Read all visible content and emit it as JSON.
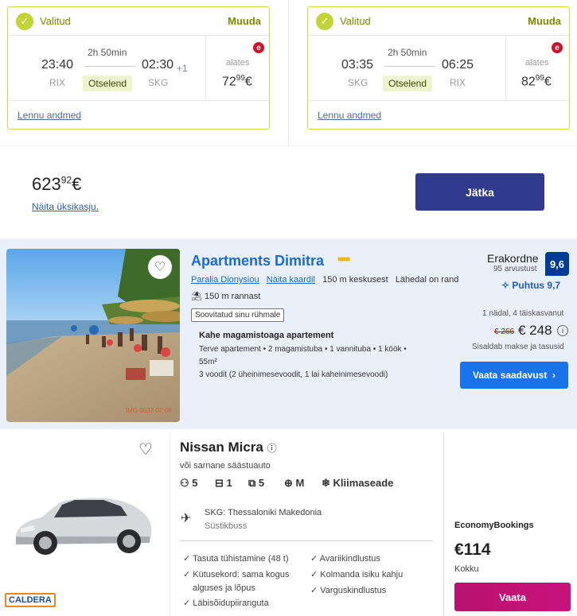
{
  "flights": [
    {
      "status": "Valitud",
      "change": "Muuda",
      "dep_time": "23:40",
      "dep_airport": "RIX",
      "duration": "2h 50min",
      "type": "Otselend",
      "arr_time": "02:30",
      "arr_airport": "SKG",
      "day_offset": "+1",
      "from_label": "alates",
      "price_main": "72",
      "price_cents": "99",
      "currency": "€",
      "details_link": "Lennu andmed"
    },
    {
      "status": "Valitud",
      "change": "Muuda",
      "dep_time": "03:35",
      "dep_airport": "SKG",
      "duration": "2h 50min",
      "type": "Otselend",
      "arr_time": "06:25",
      "arr_airport": "RIX",
      "day_offset": "",
      "from_label": "alates",
      "price_main": "82",
      "price_cents": "99",
      "currency": "€",
      "details_link": "Lennu andmed"
    }
  ],
  "total": {
    "main": "623",
    "cents": "92",
    "currency": "€",
    "show_separate": "Näita üksikasju.",
    "continue": "Jätka"
  },
  "hotel": {
    "name": "Apartments Dimitra",
    "stars": 3,
    "location": "Paralia Dionysiou",
    "map_link": "Näita kaardil",
    "center_distance": "150 m keskusest",
    "beach_near": "Lähedal on rand",
    "beach_distance": "150 m rannast",
    "group_badge": "Soovitatud sinu rühmale",
    "room_type": "Kahe magamistoaga apartement",
    "room_desc": "Terve apartement • 2 magamistuba • 1 vannituba • 1 köök •",
    "room_size": "55m²",
    "beds": "3 voodit (2 üheinimesevoodit, 1 lai kaheinimesevoodi)",
    "rating_word": "Erakordne",
    "reviews": "95 arvustust",
    "score": "9,6",
    "cleanliness": "Puhtus 9,7",
    "stay": "1 nädal, 4 täiskasvanut",
    "old_price": "€ 266",
    "price": "€ 248",
    "taxes": "Sisaldab makse ja tasusid",
    "cta": "Vaata saadavust",
    "photo_watermark": "IMG 0037 07 06"
  },
  "car": {
    "name": "Nissan Micra",
    "similar": "või sarnane säästuauto",
    "seats": "5",
    "small_bags": "1",
    "large_bags": "5",
    "transmission": "M",
    "ac": "Kliimaseade",
    "pickup": "SKG: Thessaloniki Makedonia",
    "shuttle": "Süstikbuss",
    "features_left": [
      "Tasuta tühistamine (48 t)",
      "Kütusekord: sama kogus",
      "alguses ja lõpus",
      "Läbisõidupiiranguta"
    ],
    "features_right": [
      "Avariikindlustus",
      "Kolmanda isiku kahju",
      "Varguskindlustus"
    ],
    "supplier": "EconomyBookings",
    "price": "€114",
    "price_label": "Kokku",
    "cta": "Vaata",
    "brand_logo": "CALDERA"
  },
  "colors": {
    "accent_green": "#c3d437",
    "dark_blue": "#313b8e",
    "link_blue": "#1a6ad0",
    "booking_blue": "#003b95",
    "magenta": "#c8127c"
  }
}
